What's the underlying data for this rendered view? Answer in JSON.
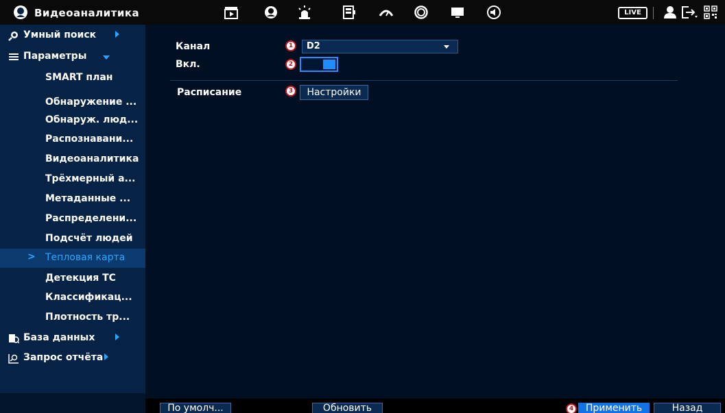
{
  "app": {
    "title": "Видеоаналитика",
    "live_label": "LIVE"
  },
  "toolbar": {
    "icons": [
      "playback-icon",
      "ai-face-icon",
      "alarm-icon",
      "storage-icon",
      "network-icon",
      "sync-icon",
      "display-icon",
      "audio-icon"
    ]
  },
  "sidebar": {
    "sections": [
      {
        "label": "Умный поиск",
        "icon": "smart-search-icon"
      },
      {
        "label": "Параметры",
        "icon": "list-icon"
      },
      {
        "label": "База данных",
        "icon": "database-icon"
      },
      {
        "label": "Запрос отчёта",
        "icon": "report-icon"
      }
    ],
    "items": [
      {
        "label": "SMART план"
      },
      {
        "label": "Обнаружение ..."
      },
      {
        "label": "Обнаруж. люд..."
      },
      {
        "label": "Распознавани..."
      },
      {
        "label": "Видеоаналитика"
      },
      {
        "label": "Трёхмерный а..."
      },
      {
        "label": "Метаданные ..."
      },
      {
        "label": "Распределени..."
      },
      {
        "label": "Подсчёт людей"
      },
      {
        "label": "Тепловая карта",
        "chevron": ">"
      },
      {
        "label": "Детекция ТС"
      },
      {
        "label": "Классификац..."
      },
      {
        "label": "Плотность тр..."
      }
    ]
  },
  "form": {
    "channel_label": "Канал",
    "channel_value": "D2",
    "enable_label": "Вкл.",
    "enable_state": true,
    "schedule_label": "Расписание",
    "schedule_button": "Настройки",
    "badges": [
      "1",
      "2",
      "3",
      "4"
    ]
  },
  "footer": {
    "default_button": "По умолч...",
    "refresh_button": "Обновить",
    "apply_button": "Применить",
    "back_button": "Назад"
  },
  "colors": {
    "sidebar_bg": "#062346",
    "content_bg": "#010f22",
    "accent": "#2aa6ff",
    "primary_button": "#1273e6",
    "badge_border": "#c0161c"
  }
}
